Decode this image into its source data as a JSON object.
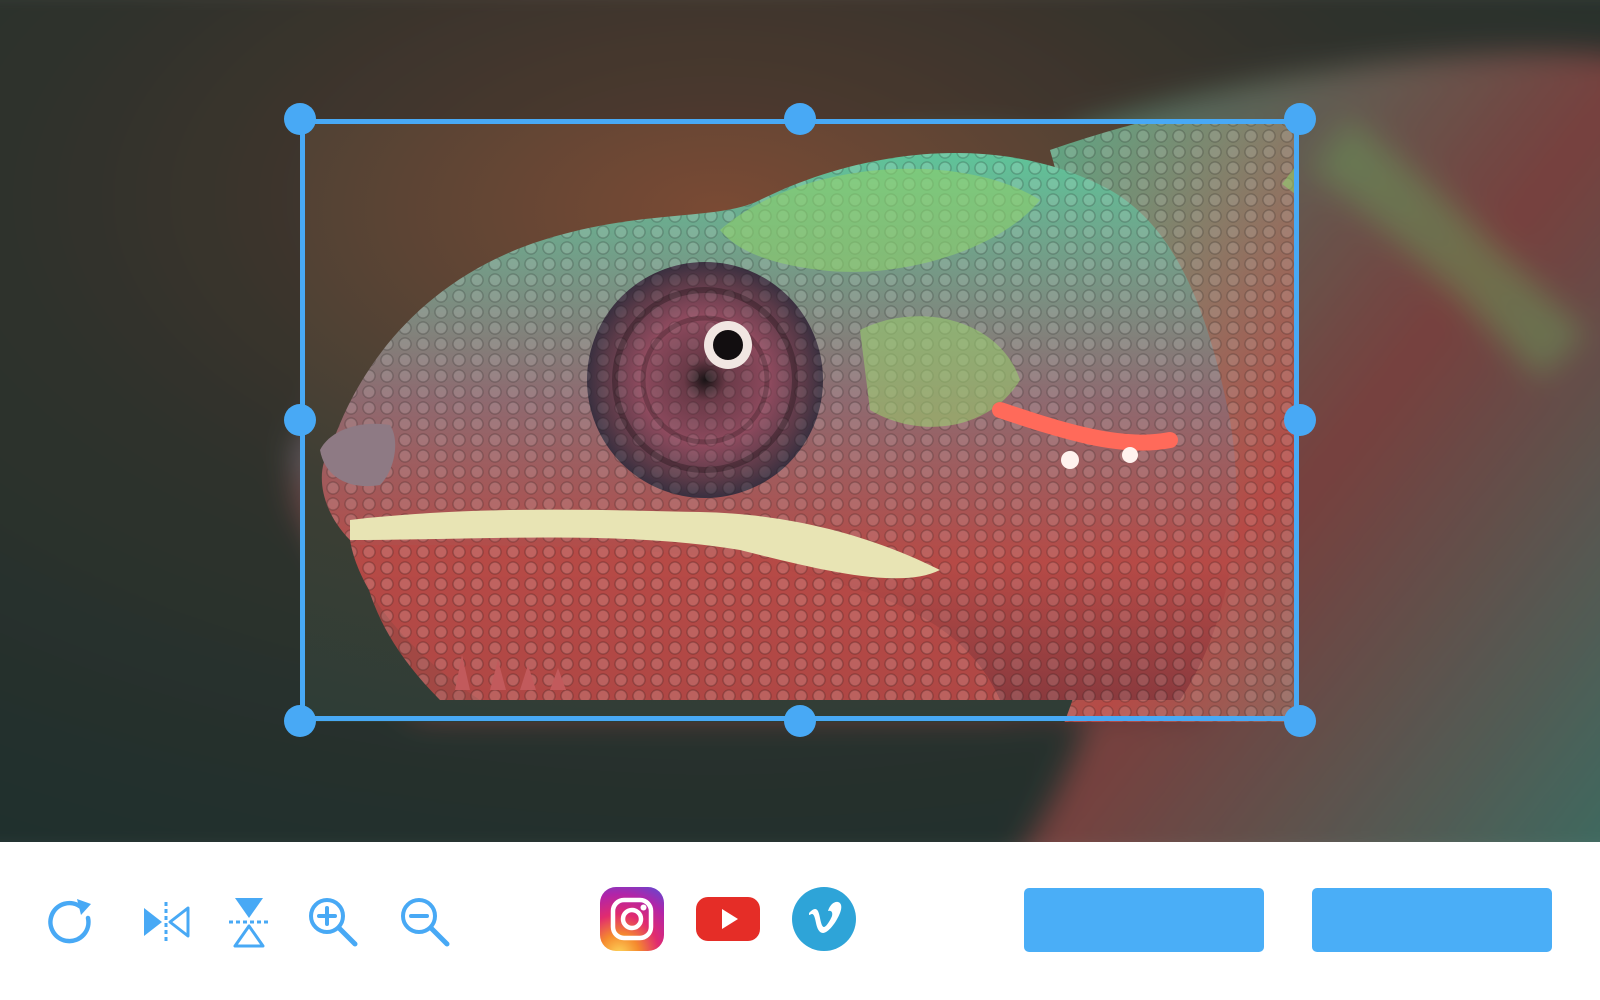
{
  "image": {
    "subject": "chameleon-head-closeup",
    "colors": {
      "background_dark": "#23403a",
      "background_brown": "#6a4432",
      "scale_green": "#4fb890",
      "scale_lime": "#8ed06a",
      "scale_red": "#b64a46",
      "eye_purple": "#7e4658",
      "lip_cream": "#e8e4b4"
    }
  },
  "crop": {
    "accent_color": "#48a9f5"
  },
  "toolbar": {
    "tools": [
      {
        "icon": "rotate-icon"
      },
      {
        "icon": "flip-horizontal-icon"
      },
      {
        "icon": "flip-vertical-icon"
      },
      {
        "icon": "zoom-in-icon"
      },
      {
        "icon": "zoom-out-icon"
      }
    ],
    "share": [
      {
        "icon": "instagram-icon"
      },
      {
        "icon": "youtube-icon"
      },
      {
        "icon": "vimeo-icon"
      }
    ],
    "buttons": [
      {
        "label": "",
        "color": "#4aaef7"
      },
      {
        "label": "",
        "color": "#4aaef7"
      }
    ]
  }
}
